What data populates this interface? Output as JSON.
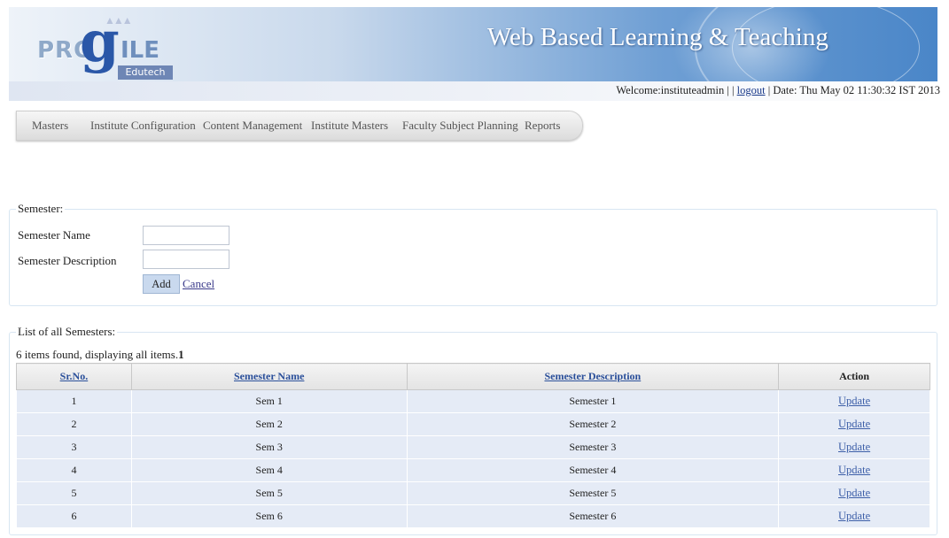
{
  "header": {
    "logo": {
      "pro": "PRO",
      "g": "g",
      "ile": "ILE",
      "edutech": "Edutech"
    },
    "site_title": "Web Based Learning & Teaching",
    "welcome_text": "Welcome:instituteadmin | |",
    "logout_label": "logout",
    "date_text": "| Date: Thu May 02 11:30:32 IST 2013"
  },
  "nav": {
    "items": [
      "Masters",
      "Institute Configuration",
      "Content Management",
      "Institute Masters",
      "Faculty Subject Planning",
      "Reports"
    ]
  },
  "form": {
    "legend": "Semester:",
    "name_label": "Semester Name",
    "description_label": "Semester Description",
    "name_value": "",
    "description_value": "",
    "add_label": "Add",
    "cancel_label": "Cancel"
  },
  "list": {
    "legend": "List of all Semesters:",
    "found_text": "6 items found, displaying all items.",
    "page_number": "1",
    "columns": [
      "Sr.No.",
      "Semester Name",
      "Semester Description",
      "Action"
    ],
    "rows": [
      {
        "sr": "1",
        "name": "Sem 1",
        "description": "Semester 1",
        "action": "Update"
      },
      {
        "sr": "2",
        "name": "Sem 2",
        "description": "Semester 2",
        "action": "Update"
      },
      {
        "sr": "3",
        "name": "Sem 3",
        "description": "Semester 3",
        "action": "Update"
      },
      {
        "sr": "4",
        "name": "Sem 4",
        "description": "Semester 4",
        "action": "Update"
      },
      {
        "sr": "5",
        "name": "Sem 5",
        "description": "Semester 5",
        "action": "Update"
      },
      {
        "sr": "6",
        "name": "Sem 6",
        "description": "Semester 6",
        "action": "Update"
      }
    ]
  },
  "colors": {
    "banner_accent": "#4a86c8",
    "row_background": "#e5ebf6",
    "link": "#3d5fa8"
  }
}
